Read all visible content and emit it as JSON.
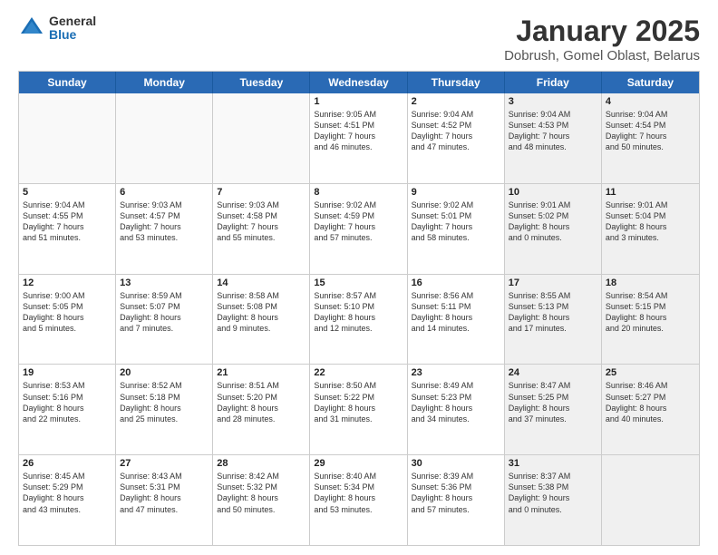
{
  "logo": {
    "general": "General",
    "blue": "Blue"
  },
  "title": "January 2025",
  "subtitle": "Dobrush, Gomel Oblast, Belarus",
  "days": [
    "Sunday",
    "Monday",
    "Tuesday",
    "Wednesday",
    "Thursday",
    "Friday",
    "Saturday"
  ],
  "weeks": [
    [
      {
        "day": "",
        "text": ""
      },
      {
        "day": "",
        "text": ""
      },
      {
        "day": "",
        "text": ""
      },
      {
        "day": "1",
        "text": "Sunrise: 9:05 AM\nSunset: 4:51 PM\nDaylight: 7 hours\nand 46 minutes."
      },
      {
        "day": "2",
        "text": "Sunrise: 9:04 AM\nSunset: 4:52 PM\nDaylight: 7 hours\nand 47 minutes."
      },
      {
        "day": "3",
        "text": "Sunrise: 9:04 AM\nSunset: 4:53 PM\nDaylight: 7 hours\nand 48 minutes."
      },
      {
        "day": "4",
        "text": "Sunrise: 9:04 AM\nSunset: 4:54 PM\nDaylight: 7 hours\nand 50 minutes."
      }
    ],
    [
      {
        "day": "5",
        "text": "Sunrise: 9:04 AM\nSunset: 4:55 PM\nDaylight: 7 hours\nand 51 minutes."
      },
      {
        "day": "6",
        "text": "Sunrise: 9:03 AM\nSunset: 4:57 PM\nDaylight: 7 hours\nand 53 minutes."
      },
      {
        "day": "7",
        "text": "Sunrise: 9:03 AM\nSunset: 4:58 PM\nDaylight: 7 hours\nand 55 minutes."
      },
      {
        "day": "8",
        "text": "Sunrise: 9:02 AM\nSunset: 4:59 PM\nDaylight: 7 hours\nand 57 minutes."
      },
      {
        "day": "9",
        "text": "Sunrise: 9:02 AM\nSunset: 5:01 PM\nDaylight: 7 hours\nand 58 minutes."
      },
      {
        "day": "10",
        "text": "Sunrise: 9:01 AM\nSunset: 5:02 PM\nDaylight: 8 hours\nand 0 minutes."
      },
      {
        "day": "11",
        "text": "Sunrise: 9:01 AM\nSunset: 5:04 PM\nDaylight: 8 hours\nand 3 minutes."
      }
    ],
    [
      {
        "day": "12",
        "text": "Sunrise: 9:00 AM\nSunset: 5:05 PM\nDaylight: 8 hours\nand 5 minutes."
      },
      {
        "day": "13",
        "text": "Sunrise: 8:59 AM\nSunset: 5:07 PM\nDaylight: 8 hours\nand 7 minutes."
      },
      {
        "day": "14",
        "text": "Sunrise: 8:58 AM\nSunset: 5:08 PM\nDaylight: 8 hours\nand 9 minutes."
      },
      {
        "day": "15",
        "text": "Sunrise: 8:57 AM\nSunset: 5:10 PM\nDaylight: 8 hours\nand 12 minutes."
      },
      {
        "day": "16",
        "text": "Sunrise: 8:56 AM\nSunset: 5:11 PM\nDaylight: 8 hours\nand 14 minutes."
      },
      {
        "day": "17",
        "text": "Sunrise: 8:55 AM\nSunset: 5:13 PM\nDaylight: 8 hours\nand 17 minutes."
      },
      {
        "day": "18",
        "text": "Sunrise: 8:54 AM\nSunset: 5:15 PM\nDaylight: 8 hours\nand 20 minutes."
      }
    ],
    [
      {
        "day": "19",
        "text": "Sunrise: 8:53 AM\nSunset: 5:16 PM\nDaylight: 8 hours\nand 22 minutes."
      },
      {
        "day": "20",
        "text": "Sunrise: 8:52 AM\nSunset: 5:18 PM\nDaylight: 8 hours\nand 25 minutes."
      },
      {
        "day": "21",
        "text": "Sunrise: 8:51 AM\nSunset: 5:20 PM\nDaylight: 8 hours\nand 28 minutes."
      },
      {
        "day": "22",
        "text": "Sunrise: 8:50 AM\nSunset: 5:22 PM\nDaylight: 8 hours\nand 31 minutes."
      },
      {
        "day": "23",
        "text": "Sunrise: 8:49 AM\nSunset: 5:23 PM\nDaylight: 8 hours\nand 34 minutes."
      },
      {
        "day": "24",
        "text": "Sunrise: 8:47 AM\nSunset: 5:25 PM\nDaylight: 8 hours\nand 37 minutes."
      },
      {
        "day": "25",
        "text": "Sunrise: 8:46 AM\nSunset: 5:27 PM\nDaylight: 8 hours\nand 40 minutes."
      }
    ],
    [
      {
        "day": "26",
        "text": "Sunrise: 8:45 AM\nSunset: 5:29 PM\nDaylight: 8 hours\nand 43 minutes."
      },
      {
        "day": "27",
        "text": "Sunrise: 8:43 AM\nSunset: 5:31 PM\nDaylight: 8 hours\nand 47 minutes."
      },
      {
        "day": "28",
        "text": "Sunrise: 8:42 AM\nSunset: 5:32 PM\nDaylight: 8 hours\nand 50 minutes."
      },
      {
        "day": "29",
        "text": "Sunrise: 8:40 AM\nSunset: 5:34 PM\nDaylight: 8 hours\nand 53 minutes."
      },
      {
        "day": "30",
        "text": "Sunrise: 8:39 AM\nSunset: 5:36 PM\nDaylight: 8 hours\nand 57 minutes."
      },
      {
        "day": "31",
        "text": "Sunrise: 8:37 AM\nSunset: 5:38 PM\nDaylight: 9 hours\nand 0 minutes."
      },
      {
        "day": "",
        "text": ""
      }
    ]
  ]
}
